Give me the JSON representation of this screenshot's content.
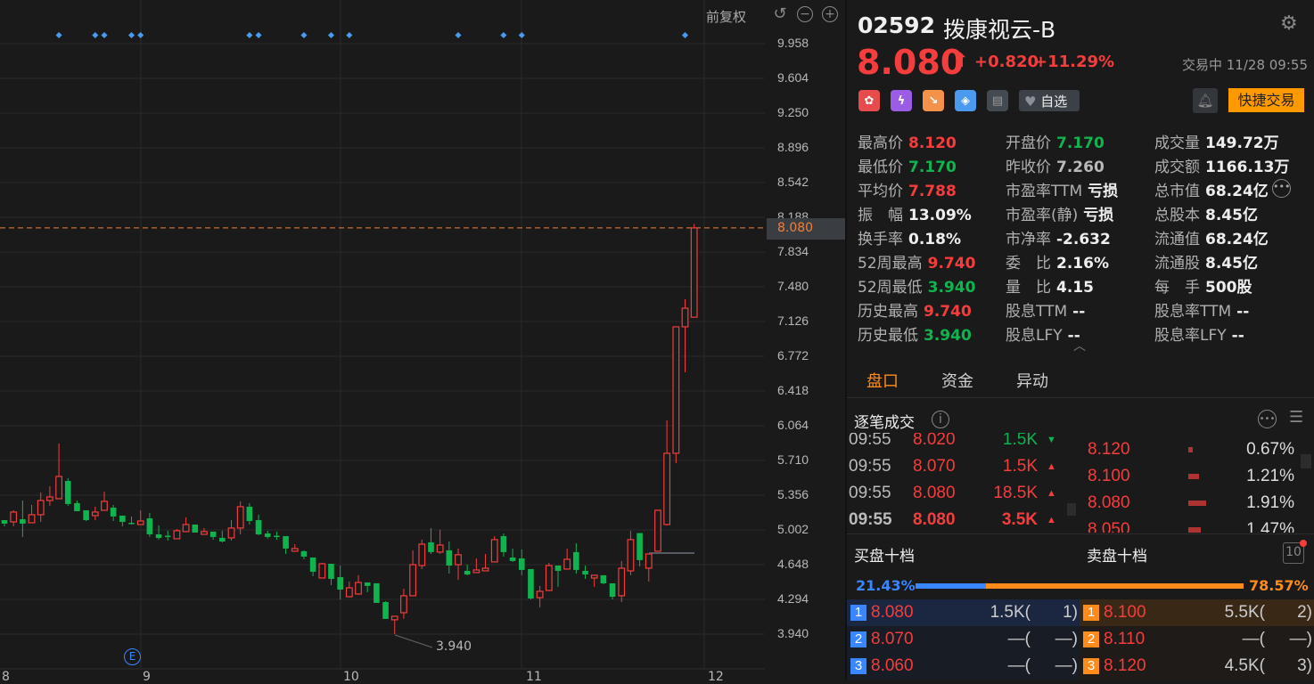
{
  "chart_controls": {
    "adjust_label": "前复权",
    "icons": [
      "undo-icon",
      "zoom-out-icon",
      "zoom-in-icon"
    ]
  },
  "chart_data": {
    "type": "candlestick",
    "y_ticks": [
      "9.958",
      "9.604",
      "9.250",
      "8.896",
      "8.542",
      "8.188",
      "7.834",
      "7.480",
      "7.126",
      "6.772",
      "6.418",
      "6.064",
      "5.710",
      "5.356",
      "5.002",
      "4.648",
      "4.294",
      "3.940"
    ],
    "ylim": [
      3.94,
      9.958
    ],
    "x_tick_labels": [
      "8",
      "9",
      "10",
      "11",
      "12"
    ],
    "current_price_label": "8.080",
    "low_annotation": "3.940",
    "event_marker_indices": [
      6,
      10,
      11,
      14,
      15,
      27,
      28,
      33,
      36,
      38,
      50,
      55,
      57,
      75
    ],
    "earnings_marker": "E",
    "up_color": "#f53d3d",
    "down_color": "#0fb44f",
    "ohlc": [
      [
        5.102,
        5.102,
        5.038,
        5.066
      ],
      [
        5.084,
        5.202,
        5.039,
        5.184
      ],
      [
        5.111,
        5.302,
        4.93,
        5.066
      ],
      [
        5.075,
        5.257,
        5.075,
        5.157
      ],
      [
        5.157,
        5.384,
        5.084,
        5.302
      ],
      [
        5.302,
        5.447,
        5.248,
        5.338
      ],
      [
        5.32,
        5.883,
        5.32,
        5.547
      ],
      [
        5.501,
        5.529,
        5.248,
        5.266
      ],
      [
        5.275,
        5.302,
        5.193,
        5.193
      ],
      [
        5.202,
        5.202,
        5.093,
        5.102
      ],
      [
        5.148,
        5.239,
        5.102,
        5.184
      ],
      [
        5.202,
        5.393,
        5.202,
        5.293
      ],
      [
        5.229,
        5.257,
        5.093,
        5.139
      ],
      [
        5.148,
        5.148,
        5.039,
        5.084
      ],
      [
        5.075,
        5.139,
        5.057,
        5.07
      ],
      [
        5.057,
        5.202,
        5.057,
        5.093
      ],
      [
        5.12,
        5.175,
        4.93,
        4.957
      ],
      [
        4.957,
        5.048,
        4.902,
        4.92
      ],
      [
        4.943,
        4.994,
        4.893,
        4.938
      ],
      [
        4.912,
        5.012,
        4.912,
        4.994
      ],
      [
        4.985,
        5.13,
        4.985,
        5.057
      ],
      [
        5.057,
        5.057,
        4.975,
        4.975
      ],
      [
        4.957,
        5.021,
        4.957,
        4.985
      ],
      [
        4.985,
        4.985,
        4.902,
        4.93
      ],
      [
        4.921,
        4.994,
        4.875,
        4.884
      ],
      [
        4.921,
        5.102,
        4.893,
        5.021
      ],
      [
        5.021,
        5.293,
        4.957,
        5.239
      ],
      [
        5.239,
        5.275,
        5.057,
        5.093
      ],
      [
        5.102,
        5.157,
        4.948,
        4.957
      ],
      [
        4.966,
        4.994,
        4.912,
        4.93
      ],
      [
        4.943,
        4.985,
        4.902,
        4.939
      ],
      [
        4.939,
        4.939,
        4.757,
        4.812
      ],
      [
        4.785,
        4.857,
        4.785,
        4.812
      ],
      [
        4.785,
        4.794,
        4.703,
        4.73
      ],
      [
        4.721,
        4.721,
        4.531,
        4.576
      ],
      [
        4.512,
        4.666,
        4.512,
        4.657
      ],
      [
        4.657,
        4.657,
        4.439,
        4.503
      ],
      [
        4.521,
        4.639,
        4.294,
        4.394
      ],
      [
        4.321,
        4.476,
        4.321,
        4.412
      ],
      [
        4.349,
        4.54,
        4.34,
        4.467
      ],
      [
        4.467,
        4.467,
        4.367,
        4.431
      ],
      [
        4.458,
        4.458,
        4.258,
        4.258
      ],
      [
        4.267,
        4.276,
        4.095,
        4.095
      ],
      [
        4.086,
        4.122,
        3.94,
        4.122
      ],
      [
        4.158,
        4.403,
        4.095,
        4.331
      ],
      [
        4.331,
        4.794,
        4.331,
        4.648
      ],
      [
        4.639,
        4.903,
        4.603,
        4.857
      ],
      [
        4.876,
        5.021,
        4.757,
        4.776
      ],
      [
        4.776,
        5.003,
        4.757,
        4.848
      ],
      [
        4.794,
        4.885,
        4.557,
        4.639
      ],
      [
        4.648,
        4.812,
        4.494,
        4.749
      ],
      [
        4.585,
        4.648,
        4.54,
        4.548
      ],
      [
        4.567,
        4.712,
        4.567,
        4.594
      ],
      [
        4.585,
        4.757,
        4.585,
        4.612
      ],
      [
        4.676,
        4.939,
        4.676,
        4.903
      ],
      [
        4.939,
        4.966,
        4.73,
        4.776
      ],
      [
        4.721,
        4.812,
        4.676,
        4.685
      ],
      [
        4.712,
        4.803,
        4.54,
        4.594
      ],
      [
        4.603,
        4.603,
        4.294,
        4.303
      ],
      [
        4.312,
        4.431,
        4.213,
        4.376
      ],
      [
        4.385,
        4.666,
        4.385,
        4.639
      ],
      [
        4.639,
        4.639,
        4.422,
        4.585
      ],
      [
        4.603,
        4.812,
        4.603,
        4.703
      ],
      [
        4.776,
        4.867,
        4.557,
        4.594
      ],
      [
        4.585,
        4.639,
        4.503,
        4.548
      ],
      [
        4.512,
        4.54,
        4.422,
        4.54
      ],
      [
        4.54,
        4.54,
        4.449,
        4.458
      ],
      [
        4.458,
        4.458,
        4.294,
        4.321
      ],
      [
        4.331,
        4.685,
        4.267,
        4.612
      ],
      [
        4.585,
        4.994,
        4.54,
        4.903
      ],
      [
        4.97,
        4.97,
        4.63,
        4.694
      ],
      [
        4.612,
        4.757,
        4.476,
        4.757
      ],
      [
        4.785,
        5.202,
        4.785,
        5.202
      ],
      [
        5.057,
        6.119,
        5.048,
        5.783
      ],
      [
        5.783,
        7.072,
        5.683,
        7.072
      ],
      [
        7.072,
        7.353,
        6.609,
        7.262
      ],
      [
        7.17,
        8.12,
        7.17,
        8.08
      ]
    ]
  },
  "header": {
    "code": "02592",
    "name": "拨康视云-B",
    "price": "8.080",
    "change": "+0.820",
    "change_pct": "+11.29%",
    "status": "交易中 11/28 09:55",
    "watch_label": "自选",
    "quick_trade": "快捷交易",
    "accent": "#ff9900"
  },
  "stats": [
    [
      {
        "l": "最高价",
        "v": "8.120",
        "c": "red"
      },
      {
        "l": "最低价",
        "v": "7.170",
        "c": "green"
      },
      {
        "l": "平均价",
        "v": "7.788",
        "c": "red"
      },
      {
        "l": "振　幅",
        "v": "13.09%",
        "c": "white"
      },
      {
        "l": "换手率",
        "v": "0.18%",
        "c": "white"
      },
      {
        "l": "52周最高",
        "v": "9.740",
        "c": "red"
      },
      {
        "l": "52周最低",
        "v": "3.940",
        "c": "green"
      },
      {
        "l": "历史最高",
        "v": "9.740",
        "c": "red"
      },
      {
        "l": "历史最低",
        "v": "3.940",
        "c": "green"
      }
    ],
    [
      {
        "l": "开盘价",
        "v": "7.170",
        "c": "green"
      },
      {
        "l": "昨收价",
        "v": "7.260",
        "c": "gray"
      },
      {
        "l": "市盈率TTM",
        "v": "亏损",
        "c": "white"
      },
      {
        "l": "市盈率(静)",
        "v": "亏损",
        "c": "white"
      },
      {
        "l": "市净率",
        "v": "-2.632",
        "c": "white"
      },
      {
        "l": "委　比",
        "v": "2.16%",
        "c": "white"
      },
      {
        "l": "量　比",
        "v": "4.15",
        "c": "white"
      },
      {
        "l": "股息TTM",
        "v": "--",
        "c": "white"
      },
      {
        "l": "股息LFY",
        "v": "--",
        "c": "white"
      }
    ],
    [
      {
        "l": "成交量",
        "v": "149.72万",
        "c": "white"
      },
      {
        "l": "成交额",
        "v": "1166.13万",
        "c": "white"
      },
      {
        "l": "总市值",
        "v": "68.24亿",
        "c": "white"
      },
      {
        "l": "总股本",
        "v": "8.45亿",
        "c": "white"
      },
      {
        "l": "流通值",
        "v": "68.24亿",
        "c": "white"
      },
      {
        "l": "流通股",
        "v": "8.45亿",
        "c": "white"
      },
      {
        "l": "每　手",
        "v": "500股",
        "c": "white"
      },
      {
        "l": "股息率TTM",
        "v": "--",
        "c": "white"
      },
      {
        "l": "股息率LFY",
        "v": "--",
        "c": "white"
      }
    ]
  ],
  "tabs": [
    {
      "label": "盘口",
      "active": true
    },
    {
      "label": "资金"
    },
    {
      "label": "异动"
    }
  ],
  "ticks": {
    "title": "逐笔成交",
    "rows": [
      {
        "time": "09:55",
        "price": "8.020",
        "vol": "1.5K",
        "dir": "down"
      },
      {
        "time": "09:55",
        "price": "8.070",
        "vol": "1.5K",
        "dir": "up"
      },
      {
        "time": "09:55",
        "price": "8.080",
        "vol": "18.5K",
        "dir": "up"
      },
      {
        "time": "09:55",
        "price": "8.080",
        "vol": "3.5K",
        "dir": "up"
      }
    ],
    "dist": [
      {
        "price": "8.120",
        "pct": "0.67%"
      },
      {
        "price": "8.100",
        "pct": "1.21%"
      },
      {
        "price": "8.080",
        "pct": "1.91%"
      },
      {
        "price": "8.050",
        "pct": "1.47%"
      }
    ]
  },
  "orderbook": {
    "bid_title": "买盘十档",
    "ask_title": "卖盘十档",
    "depth_btn": "10",
    "bid_pct": "21.43%",
    "ask_pct": "78.57%",
    "bid_ratio": 0.2143,
    "bids": [
      {
        "n": "1",
        "p": "8.080",
        "q": "1.5K(",
        "c": "1)"
      },
      {
        "n": "2",
        "p": "8.070",
        "q": "—(",
        "c": "—)"
      },
      {
        "n": "3",
        "p": "8.060",
        "q": "—(",
        "c": "—)"
      }
    ],
    "asks": [
      {
        "n": "1",
        "p": "8.100",
        "q": "5.5K(",
        "c": "2)"
      },
      {
        "n": "2",
        "p": "8.110",
        "q": "—(",
        "c": "—)"
      },
      {
        "n": "3",
        "p": "8.120",
        "q": "4.5K(",
        "c": "3)"
      }
    ]
  }
}
